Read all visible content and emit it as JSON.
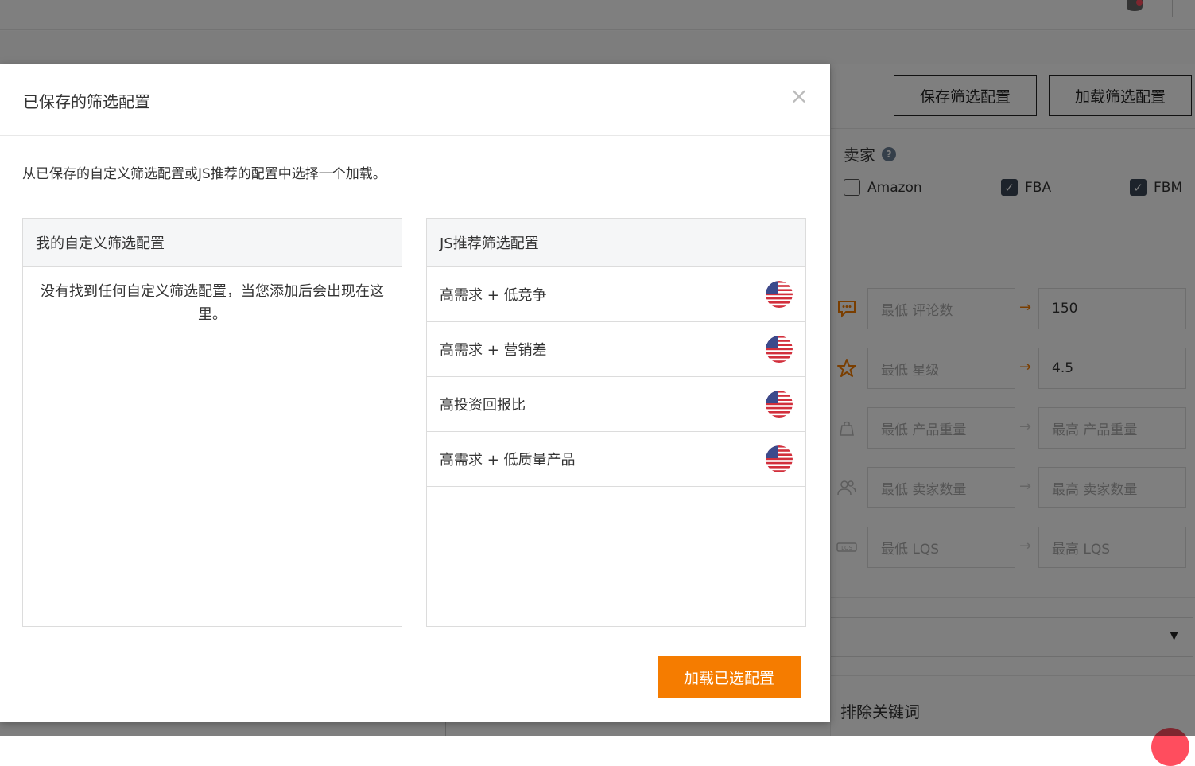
{
  "background": {
    "toolbar": {
      "save_label": "保存筛选配置",
      "load_label": "加载筛选配置"
    },
    "seller": {
      "title": "卖家",
      "help_icon": "?",
      "options": [
        {
          "label": "Amazon",
          "checked": false
        },
        {
          "label": "FBA",
          "checked": true
        },
        {
          "label": "FBM",
          "checked": true
        }
      ]
    },
    "filters": [
      {
        "icon": "comment-icon",
        "min_placeholder": "最低 评论数",
        "max_value": "150",
        "active": true
      },
      {
        "icon": "star-icon",
        "min_placeholder": "最低 星级",
        "max_value": "4.5",
        "active": true
      },
      {
        "icon": "weight-icon",
        "min_placeholder": "最低 产品重量",
        "max_placeholder": "最高 产品重量",
        "active": false
      },
      {
        "icon": "users-icon",
        "min_placeholder": "最低 卖家数量",
        "max_placeholder": "最高 卖家数量",
        "active": false
      },
      {
        "icon": "lqs-icon",
        "min_placeholder": "最低 LQS",
        "max_placeholder": "最高 LQS",
        "active": false
      }
    ],
    "select_caret": "▼",
    "exclude_title": "排除关键词"
  },
  "modal": {
    "title": "已保存的筛选配置",
    "close_glyph": "×",
    "description": "从已保存的自定义筛选配置或JS推荐的配置中选择一个加载。",
    "custom_panel": {
      "header": "我的自定义筛选配置",
      "empty_text": "没有找到任何自定义筛选配置，当您添加后会出现在这里。"
    },
    "recommended_panel": {
      "header": "JS推荐筛选配置",
      "items": [
        {
          "label": "高需求 + 低竞争",
          "flag": "us-flag-icon"
        },
        {
          "label": "高需求 + 营销差",
          "flag": "us-flag-icon"
        },
        {
          "label": "高投资回报比",
          "flag": "us-flag-icon"
        },
        {
          "label": "高需求 + 低质量产品",
          "flag": "us-flag-icon"
        }
      ]
    },
    "primary_button": "加载已选配置"
  },
  "colors": {
    "accent": "#f57c00",
    "overlay": "rgba(0,0,0,0.5)",
    "checkbox": "#3b4756"
  }
}
